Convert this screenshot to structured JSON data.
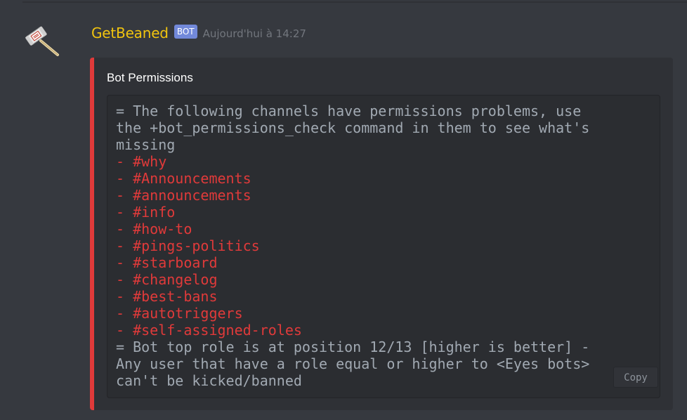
{
  "message": {
    "username": "GetBeaned",
    "bot_tag": "BOT",
    "timestamp": "Aujourd'hui à 14:27",
    "avatar_icon": "ban-hammer-icon"
  },
  "embed": {
    "accent_color": "#e03a3a",
    "title": "Bot Permissions",
    "code_lines": [
      {
        "text": "= The following channels have permissions problems, use",
        "type": "normal"
      },
      {
        "text": "the +bot_permissions_check command in them to see what's",
        "type": "normal"
      },
      {
        "text": "missing",
        "type": "normal"
      },
      {
        "text": "- #why",
        "type": "channel"
      },
      {
        "text": "- #Announcements",
        "type": "channel"
      },
      {
        "text": "- #announcements",
        "type": "channel"
      },
      {
        "text": "- #info",
        "type": "channel"
      },
      {
        "text": "- #how-to",
        "type": "channel"
      },
      {
        "text": "- #pings-politics",
        "type": "channel"
      },
      {
        "text": "- #starboard",
        "type": "channel"
      },
      {
        "text": "- #changelog",
        "type": "channel"
      },
      {
        "text": "- #best-bans",
        "type": "channel"
      },
      {
        "text": "- #autotriggers",
        "type": "channel"
      },
      {
        "text": "- #self-assigned-roles",
        "type": "channel"
      },
      {
        "text": "= Bot top role is at position 12/13 [higher is better] -",
        "type": "normal"
      },
      {
        "text": "Any user that have a role equal or higher to <Eyes bots>",
        "type": "normal"
      },
      {
        "text": "can't be kicked/banned",
        "type": "normal"
      }
    ],
    "copy_label": "Copy"
  },
  "colors": {
    "background": "#36393f",
    "username": "#f1c40f",
    "bot_tag": "#7289da",
    "channel_text": "#e03a3a",
    "code_text": "#a1a9b2"
  }
}
